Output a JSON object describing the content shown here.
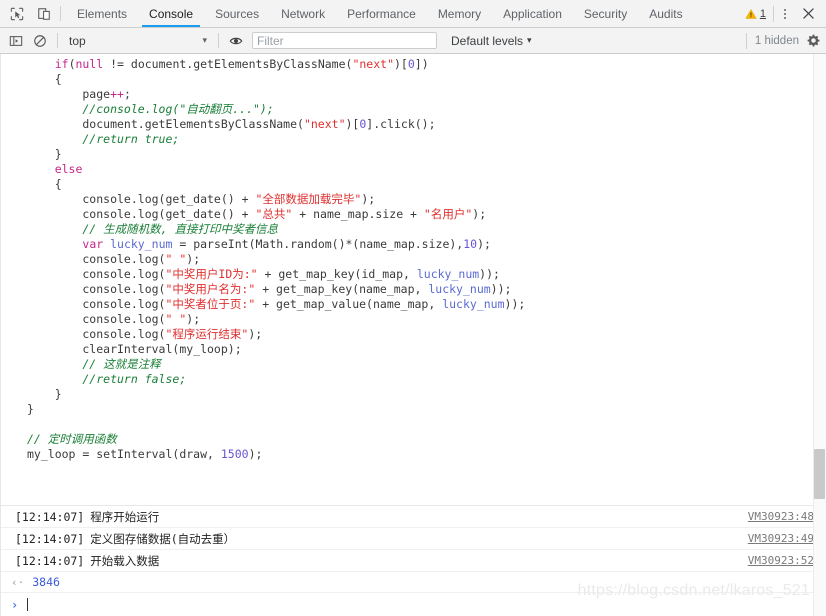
{
  "toolbar": {
    "inspect_icon": "inspect-cursor-icon",
    "device_icon": "device-toolbar-icon",
    "tabs": [
      {
        "label": "Elements",
        "active": false
      },
      {
        "label": "Console",
        "active": true
      },
      {
        "label": "Sources",
        "active": false
      },
      {
        "label": "Network",
        "active": false
      },
      {
        "label": "Performance",
        "active": false
      },
      {
        "label": "Memory",
        "active": false
      },
      {
        "label": "Application",
        "active": false
      },
      {
        "label": "Security",
        "active": false
      },
      {
        "label": "Audits",
        "active": false
      }
    ],
    "warning_count": "1",
    "warning_icon": "warning-triangle-icon",
    "more_icon": "kebab-menu-icon",
    "close_icon": "close-icon"
  },
  "filterbar": {
    "sidebar_icon": "console-sidebar-toggle-icon",
    "clear_icon": "clear-console-icon",
    "context": "top",
    "context_caret": "▾",
    "eye_icon": "live-expression-eye-icon",
    "filter_placeholder": "Filter",
    "filter_value": "",
    "levels_label": "Default levels",
    "levels_caret": "▾",
    "hidden_label": "1 hidden",
    "settings_icon": "gear-icon"
  },
  "code": {
    "lines": [
      [
        {
          "t": "    ",
          "c": "fn"
        },
        {
          "t": "if",
          "c": "kw"
        },
        {
          "t": "(",
          "c": "fn"
        },
        {
          "t": "null",
          "c": "kw"
        },
        {
          "t": " != document.getElementsByClassName(",
          "c": "fn"
        },
        {
          "t": "\"next\"",
          "c": "str"
        },
        {
          "t": ")[",
          "c": "fn"
        },
        {
          "t": "0",
          "c": "num"
        },
        {
          "t": "])",
          "c": "fn"
        }
      ],
      [
        {
          "t": "    {",
          "c": "fn"
        }
      ],
      [
        {
          "t": "        page",
          "c": "fn"
        },
        {
          "t": "++",
          "c": "kw"
        },
        {
          "t": ";",
          "c": "fn"
        }
      ],
      [
        {
          "t": "        //console.log(\"自动翻页...\");",
          "c": "cmt"
        }
      ],
      [
        {
          "t": "        document.getElementsByClassName(",
          "c": "fn"
        },
        {
          "t": "\"next\"",
          "c": "str"
        },
        {
          "t": ")[",
          "c": "fn"
        },
        {
          "t": "0",
          "c": "num"
        },
        {
          "t": "].click();",
          "c": "fn"
        }
      ],
      [
        {
          "t": "        //return true;",
          "c": "cmt"
        }
      ],
      [
        {
          "t": "    }",
          "c": "fn"
        }
      ],
      [
        {
          "t": "    ",
          "c": "fn"
        },
        {
          "t": "else",
          "c": "kw"
        }
      ],
      [
        {
          "t": "    {",
          "c": "fn"
        }
      ],
      [
        {
          "t": "        console.log(get_date() + ",
          "c": "fn"
        },
        {
          "t": "\"全部数据加载完毕\"",
          "c": "str"
        },
        {
          "t": ");",
          "c": "fn"
        }
      ],
      [
        {
          "t": "        console.log(get_date() + ",
          "c": "fn"
        },
        {
          "t": "\"总共\"",
          "c": "str"
        },
        {
          "t": " + name_map.size + ",
          "c": "fn"
        },
        {
          "t": "\"名用户\"",
          "c": "str"
        },
        {
          "t": ");",
          "c": "fn"
        }
      ],
      [
        {
          "t": "        // 生成随机数, 直接打印中奖者信息",
          "c": "cmt"
        }
      ],
      [
        {
          "t": "        ",
          "c": "fn"
        },
        {
          "t": "var",
          "c": "kw"
        },
        {
          "t": " ",
          "c": "fn"
        },
        {
          "t": "lucky_num",
          "c": "var"
        },
        {
          "t": " = parseInt(Math.random()*(name_map.size),",
          "c": "fn"
        },
        {
          "t": "10",
          "c": "num"
        },
        {
          "t": ");",
          "c": "fn"
        }
      ],
      [
        {
          "t": "        console.log(",
          "c": "fn"
        },
        {
          "t": "\" \"",
          "c": "str"
        },
        {
          "t": ");",
          "c": "fn"
        }
      ],
      [
        {
          "t": "        console.log(",
          "c": "fn"
        },
        {
          "t": "\"中奖用户ID为:\"",
          "c": "str"
        },
        {
          "t": " + get_map_key(id_map, ",
          "c": "fn"
        },
        {
          "t": "lucky_num",
          "c": "var"
        },
        {
          "t": "));",
          "c": "fn"
        }
      ],
      [
        {
          "t": "        console.log(",
          "c": "fn"
        },
        {
          "t": "\"中奖用户名为:\"",
          "c": "str"
        },
        {
          "t": " + get_map_key(name_map, ",
          "c": "fn"
        },
        {
          "t": "lucky_num",
          "c": "var"
        },
        {
          "t": "));",
          "c": "fn"
        }
      ],
      [
        {
          "t": "        console.log(",
          "c": "fn"
        },
        {
          "t": "\"中奖者位于页:\"",
          "c": "str"
        },
        {
          "t": " + get_map_value(name_map, ",
          "c": "fn"
        },
        {
          "t": "lucky_num",
          "c": "var"
        },
        {
          "t": "));",
          "c": "fn"
        }
      ],
      [
        {
          "t": "        console.log(",
          "c": "fn"
        },
        {
          "t": "\" \"",
          "c": "str"
        },
        {
          "t": ");",
          "c": "fn"
        }
      ],
      [
        {
          "t": "        console.log(",
          "c": "fn"
        },
        {
          "t": "\"程序运行结束\"",
          "c": "str"
        },
        {
          "t": ");",
          "c": "fn"
        }
      ],
      [
        {
          "t": "        clearInterval(my_loop);",
          "c": "fn"
        }
      ],
      [
        {
          "t": "        // 这就是注释",
          "c": "cmt"
        }
      ],
      [
        {
          "t": "        //return false;",
          "c": "cmt"
        }
      ],
      [
        {
          "t": "    }",
          "c": "fn"
        }
      ],
      [
        {
          "t": "}",
          "c": "fn"
        }
      ],
      [
        {
          "t": "",
          "c": "fn"
        }
      ],
      [
        {
          "t": "// 定时调用函数",
          "c": "cmt"
        }
      ],
      [
        {
          "t": "my_loop = setInterval(draw, ",
          "c": "fn"
        },
        {
          "t": "1500",
          "c": "num"
        },
        {
          "t": ");",
          "c": "fn"
        }
      ]
    ]
  },
  "logs": [
    {
      "timestamp": "[12:14:07]",
      "message": "程序开始运行",
      "source": "VM30923:48"
    },
    {
      "timestamp": "[12:14:07]",
      "message": "定义图存储数据(自动去重）",
      "source": "VM30923:49"
    },
    {
      "timestamp": "[12:14:07]",
      "message": "开始载入数据",
      "source": "VM30923:52"
    }
  ],
  "result": {
    "arrow": "‹·",
    "value": "3846"
  },
  "prompt": {
    "arrow": "›",
    "value": ""
  },
  "watermark": "https://blog.csdn.net/lkaros_521",
  "colors": {
    "accent": "#1a9cf0",
    "keyword": "#c5268b",
    "string": "#e02f2f",
    "comment": "#1a7f37",
    "number": "#6a53d4",
    "variable": "#5b6ad0",
    "result": "#3b5bdb",
    "chrome_bg": "#f3f3f3"
  }
}
